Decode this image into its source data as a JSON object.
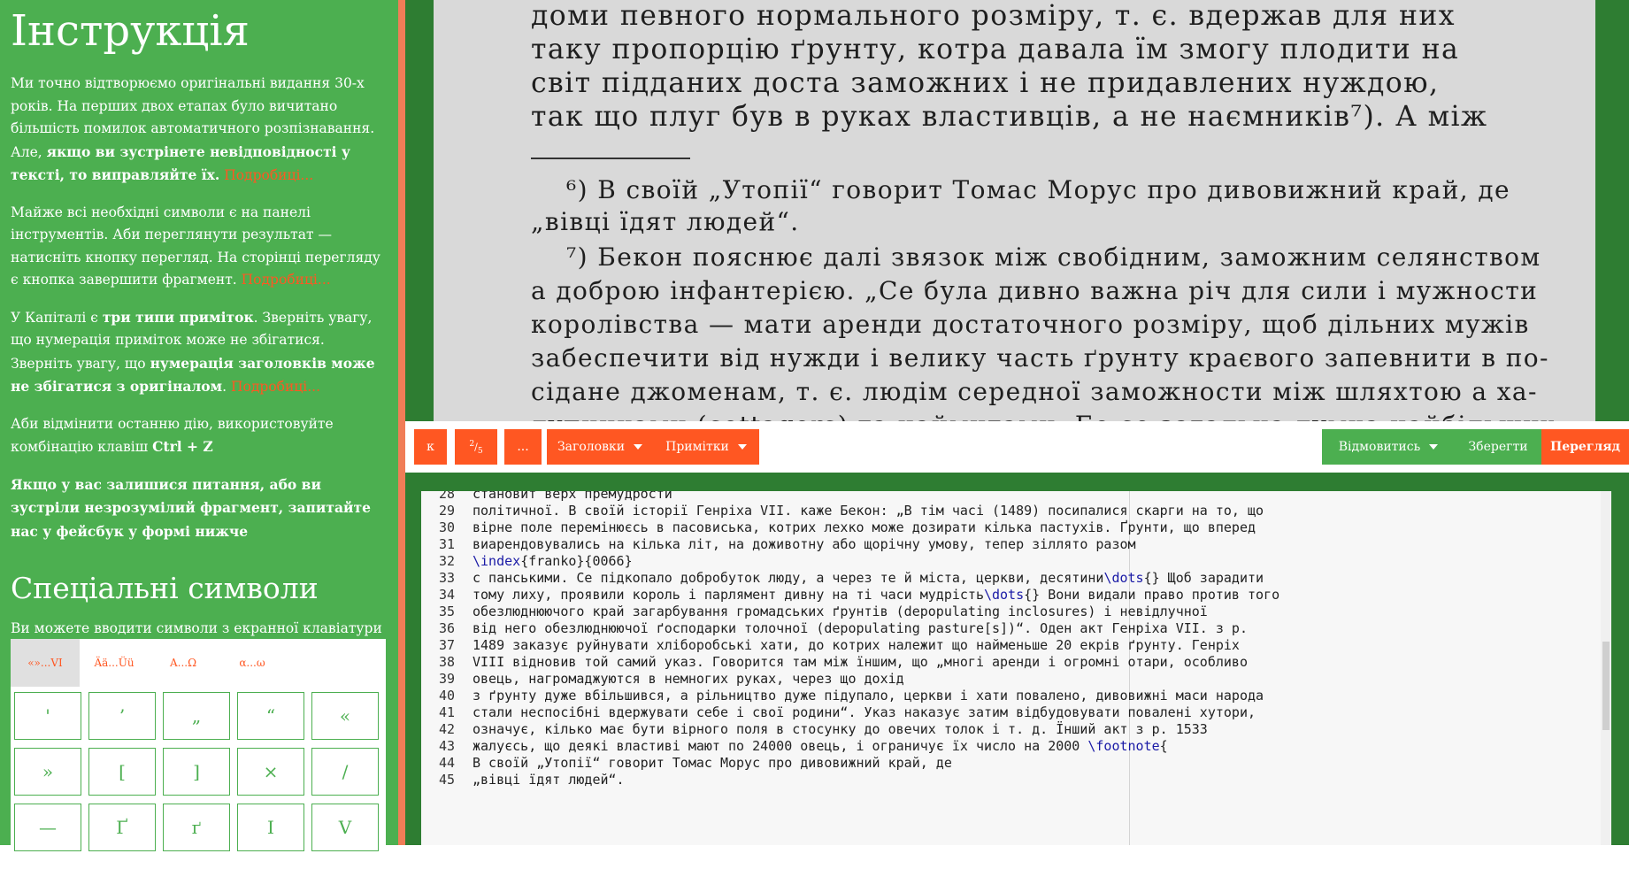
{
  "sidebar": {
    "title": "Інструкція",
    "p1": {
      "text": "Ми точно відтворюємо оригінальні видання 30-х років. На перших двох етапах було вичитано більшість помилок автоматичного розпізнавання. Але, ",
      "bold": "якщо ви зустрінете невідповідності у тексті, то виправляйте їх",
      "tail": ".",
      "more": "Подробиці..."
    },
    "p2": {
      "text": "Майже всі необхідні символи є на панелі інструментів. Аби переглянути результат — натисніть кнопку перегляд. На сторінці перегляду є кнопка завершити фрагмент.",
      "more": "Подробиці..."
    },
    "p3": {
      "a": "У Капіталі є ",
      "b1": "три типи приміток",
      "c": ". Зверніть увагу, що нумерація приміток може не збігатися. Зверніть увагу, що ",
      "b2": "нумерація заголовків може не збігатися з оригіналом",
      "d": ".",
      "more": "Подробиці..."
    },
    "p4": {
      "text": "Аби відмінити останню дію, використовуйте комбінацію клавіш ",
      "bold": "Ctrl + Z"
    },
    "p5": "Якщо у вас залишися питання, або ви зустріли незрозумілий фрагмент, запитайте нас у фейсбук у формі нижче",
    "special_title": "Спеціальні символи",
    "special_desc": "Ви можете вводити символи з екранної клавіатури",
    "symbol_tabs": [
      "«»...VI",
      "Ää...Üü",
      "Α...Ω",
      "α...ω"
    ],
    "symbol_keys": [
      "'",
      "’",
      "„",
      "“",
      "«",
      "»",
      "[",
      "]",
      "×",
      "/",
      "—",
      "Ґ",
      "ґ",
      "І",
      "V"
    ]
  },
  "scan": {
    "lines": [
      "доми певного нормального розміру, т. є. вдержав для них",
      "таку пропорцію ґрунту, котра давала їм змогу плодити на",
      "світ підданих доста заможних і не придавлених нуждою,",
      "так що плуг був в руках властивців, а не наємників⁷). А між",
      "⁶) В своїй „Утопії“ говорит Томас Морус про дивовижний край, де",
      "„вівці їдят людей“.",
      "⁷) Бекон пояснює далі звязок між свобідним, заможним селянством",
      "а доброю інфантерією. „Се була дивно важна річ для сили і мужности",
      "королівства — мати аренди достаточного розміру, щоб дільних мужів",
      "забеспечити від нужди і велику часть ґрунту краєвого запевнити в по-",
      "сідане джоменам, т. є. людім середної заможности між шляхтою а ха-",
      "лупниками (cottagers) та наймитами. Бо се загальна думка найбільших"
    ]
  },
  "toolbar": {
    "btn_k": "к",
    "btn_frac_num": "2",
    "btn_frac_den": "5",
    "btn_dots": "...",
    "btn_headings": "Заголовки",
    "btn_notes": "Примітки",
    "btn_refuse": "Відмовитись",
    "btn_save": "Зберегти",
    "btn_preview": "Перегляд"
  },
  "editor": {
    "lines": [
      {
        "n": "28",
        "text": "становит верх премудрости"
      },
      {
        "n": "29",
        "text": "політичної. В своїй історії Генріха VII. каже Бекон: „В тім часі (1489) посипалися скарги на то, що"
      },
      {
        "n": "30",
        "text": "вірне поле перемінюєсь в пасовиська, котрих лехко може дозирати кілька пастухів. Ґрунти, що вперед"
      },
      {
        "n": "31",
        "text": "виарендовувались на кілька літ, на доживотну або щорічну умову, тепер зіллято разом"
      },
      {
        "n": "32",
        "kw": "\\index",
        "text": "{franko}{0066}"
      },
      {
        "n": "33",
        "text": "с панськими. Се підкопало добробуток люду, а через те й міста, церкви, десятини",
        "kw2": "\\dots",
        "tail": "{} Щоб зарадити"
      },
      {
        "n": "34",
        "text": "тому лиху, проявили король і парлямент дивну на ті часи мудрість",
        "kw2": "\\dots",
        "tail": "{} Вони видали право против того"
      },
      {
        "n": "35",
        "text": "обезлюднюючого край загарбування громадських ґрунтів (depopulating inclosures) і невідлучної"
      },
      {
        "n": "36",
        "text": "від него обезлюднюючої ґосподарки толочної (depopulating pasture[s])“. Оден акт Генріха VII. з р."
      },
      {
        "n": "37",
        "text": "1489 заказує руйнувати хліборобські хати, до котрих належит що найменьше 20 екрів ґрунту. Генріх"
      },
      {
        "n": "38",
        "text": "VIII відновив той самий указ. Говорится там між їншим, що „многі аренди і огромні отари, особливо"
      },
      {
        "n": "39",
        "text": "овець, нагромаджуются в немногих руках, через що дохід"
      },
      {
        "n": "40",
        "text": "з ґрунту дуже вбільшився, а рільництво дуже підупало, церкви і хати повалено, дивовижні маси народа"
      },
      {
        "n": "41",
        "text": "стали неспосібні вдержувати себе і свої родини“. Указ наказує затим відбудовувати повалені хутори,"
      },
      {
        "n": "42",
        "text": "означує, кілько має бути вірного поля в стосунку до овечих толок і т. д. Їнший акт з р. 1533"
      },
      {
        "n": "43",
        "text": "жалуєсь, що деякі властиві мают по 24000 овець, і ограничує їх число на 2000 ",
        "kw2": "\\footnote",
        "tail": "{"
      },
      {
        "n": "44",
        "text": "В своїй „Утопії“ говорит Томас Морус про дивовижний край, де"
      },
      {
        "n": "45",
        "text": "„вівці їдят людей“."
      }
    ]
  }
}
